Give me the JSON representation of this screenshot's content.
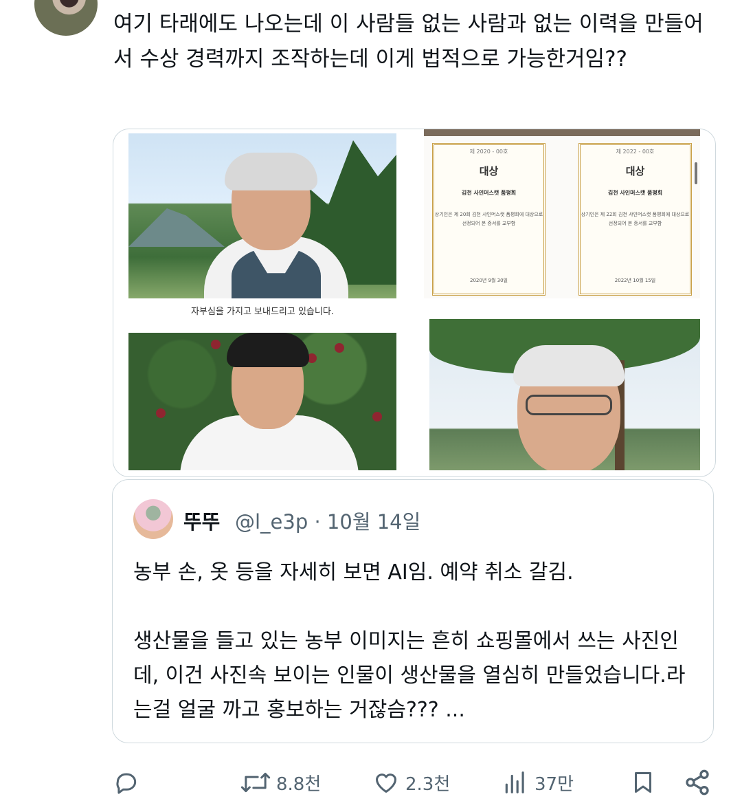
{
  "tweet": {
    "text": "여기 타래에도 나오는데 이 사람들 없는 사람과 없는 이력을 만들어서 수상 경력까지 조작하는데 이게 법적으로 가능한거임??"
  },
  "media": {
    "caption": "자부심을 가지고 보내드리고 있습니다.",
    "certificates": [
      {
        "top": "제 2020 - 00호",
        "title": "대상",
        "org": "김천 사인머스캣 품평회",
        "body": "상기인은 제 20회 김천 샤인머스캣 품평회에 대상으로 선정되어 본 증서를 교부함",
        "date": "2020년 9월 30일"
      },
      {
        "top": "제 2022 - 00호",
        "title": "대상",
        "org": "김천 사인머스캣 품평회",
        "body": "상기인은 제 22회 김천 샤인머스캣 품평회에 대상으로 선정되어 본 증서를 교부함",
        "date": "2022년 10월 15일"
      }
    ]
  },
  "quote": {
    "name": "뚜뚜",
    "handle_date": "@l_e3p · 10월 14일",
    "para1": "농부 손, 옷 등을 자세히 보면 AI임. 예약 취소 갈김.",
    "para2": "생산물을 들고 있는 농부 이미지는 흔히 쇼핑몰에서 쓰는 사진인데, 이건 사진속 보이는 인물이 생산물을 열심히 만들었습니다.라는걸 얼굴 까고 홍보하는 거잖슴??? ..."
  },
  "actions": {
    "reply": "",
    "retweets": "8.8천",
    "likes": "2.3천",
    "views": "37만"
  },
  "colors": {
    "text": "#0f1419",
    "muted": "#536471",
    "border": "#cfd9de"
  }
}
